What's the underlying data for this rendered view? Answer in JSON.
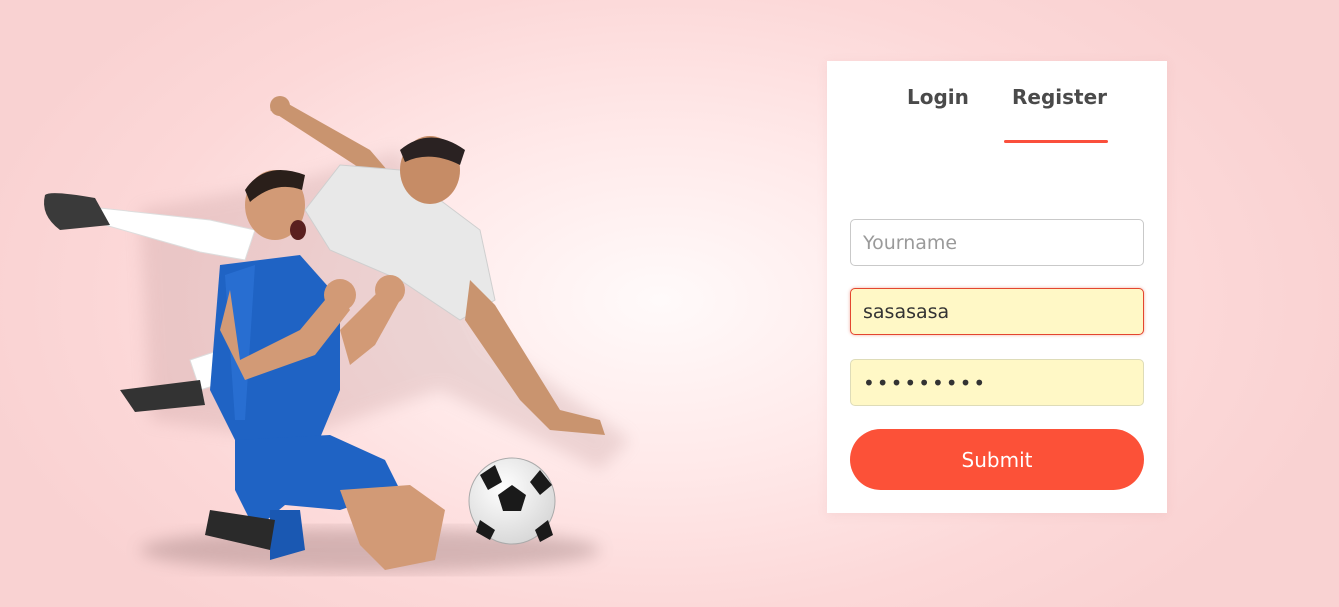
{
  "tabs": {
    "login_label": "Login",
    "register_label": "Register",
    "active": "Register"
  },
  "form": {
    "name_placeholder": "Yourname",
    "name_value": "",
    "email_value": "sasasasa",
    "password_value": "•••••••••",
    "submit_label": "Submit"
  },
  "hero": {
    "image": "football-players-celebrating-photo"
  },
  "colors": {
    "accent": "#fc5138",
    "autofill_bg": "#fff8c6",
    "error_border": "#e3462f",
    "tab_text": "#4a4a4a"
  }
}
